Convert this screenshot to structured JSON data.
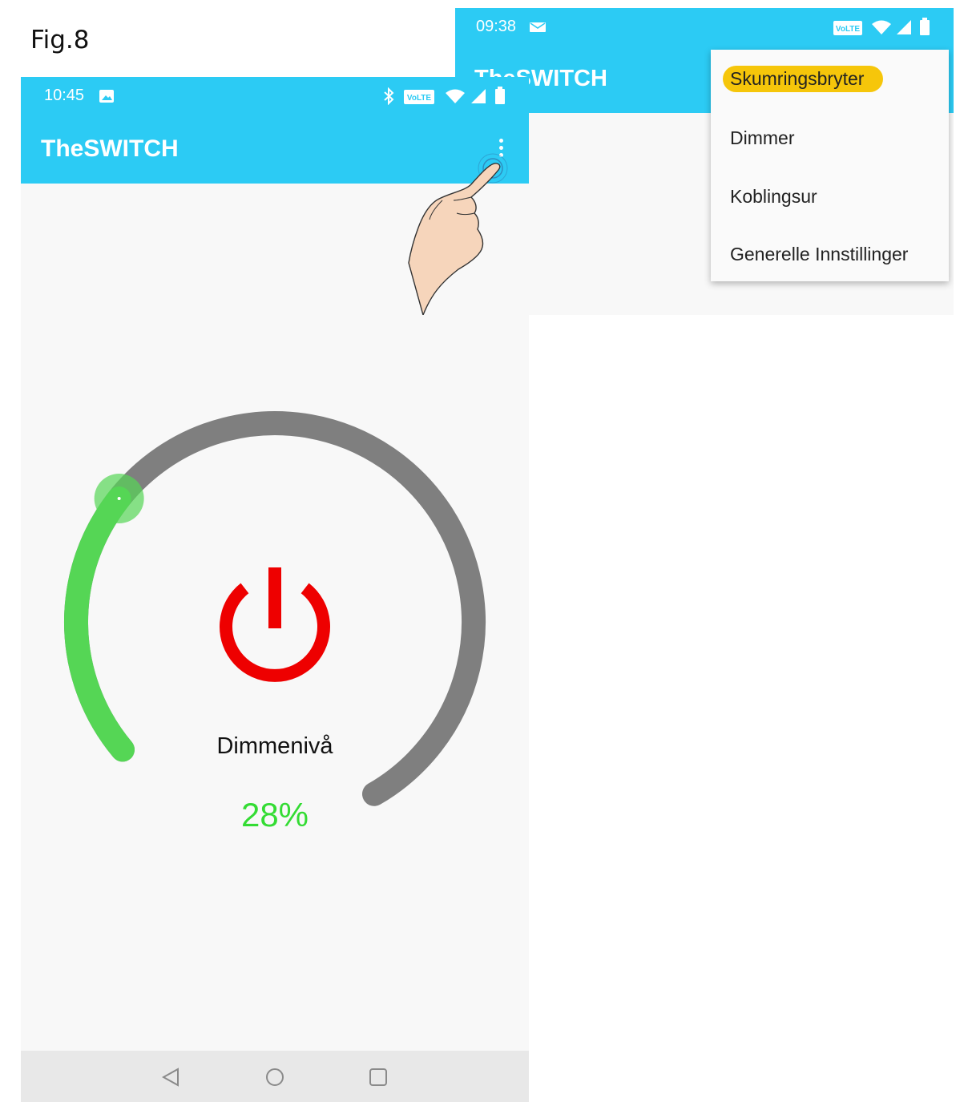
{
  "figure": {
    "label": "Fig.8"
  },
  "menu_screen": {
    "status": {
      "time": "09:38",
      "volte": "VoLTE"
    },
    "app_title": "TheSWITCH",
    "menu": {
      "items": [
        {
          "label": "Skumringsbryter",
          "highlighted": true
        },
        {
          "label": "Dimmer"
        },
        {
          "label": "Koblingsur"
        },
        {
          "label": "Generelle Innstillinger"
        }
      ],
      "highlight_color": "#f6c60a"
    }
  },
  "main_screen": {
    "status": {
      "time": "10:45",
      "volte": "VoLTE"
    },
    "app_title": "TheSWITCH",
    "dimmer": {
      "label": "Dimmenivå",
      "value_text": "28%",
      "level": 0.28,
      "active_color": "#55d655",
      "track_color": "#7f7f7f",
      "power_color": "#ee0000"
    },
    "colors": {
      "app_bar": "#2ccbf4",
      "value": "#34dc34"
    }
  }
}
